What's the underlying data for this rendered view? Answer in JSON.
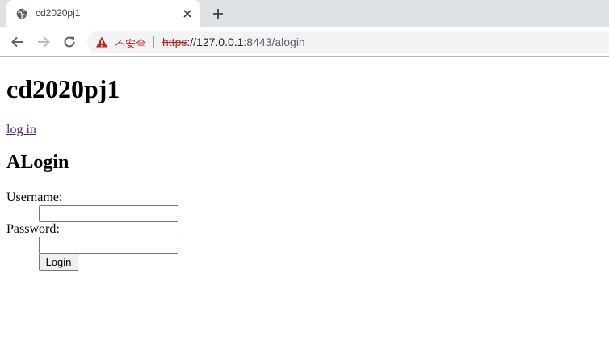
{
  "browser": {
    "tab": {
      "title": "cd2020pj1"
    },
    "address_bar": {
      "security_label": "不安全",
      "url_scheme": "https",
      "url_rest": "://127.0.0.1",
      "url_port_path": ":8443/alogin"
    },
    "colors": {
      "insecure": "#c5221f",
      "tabstrip": "#dee1e6",
      "omnibox": "#f1f3f4"
    },
    "icons": [
      "globe-icon",
      "close-icon",
      "plus-icon",
      "back-arrow-icon",
      "forward-arrow-icon",
      "reload-icon",
      "warning-icon"
    ]
  },
  "page": {
    "site_title": "cd2020pj1",
    "login_link": "log in",
    "form_title": "ALogin",
    "username_label": "Username:",
    "password_label": "Password:",
    "username_value": "",
    "password_value": "",
    "login_button": "Login"
  }
}
